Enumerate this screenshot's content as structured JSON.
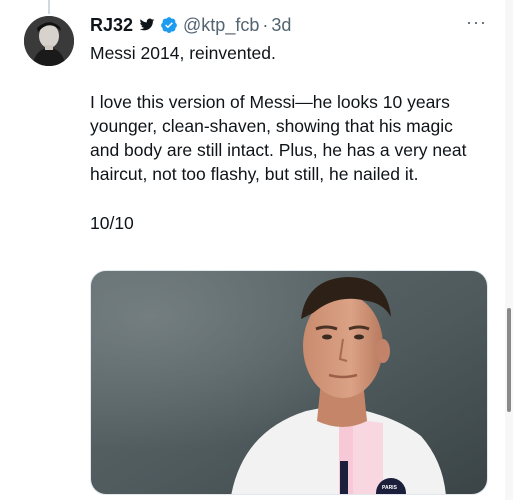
{
  "tweet": {
    "display_name": "RJ32",
    "handle": "@ktp_fcb",
    "separator": "·",
    "time": "3d",
    "line1": "Messi 2014, reinvented.",
    "body": "I love this version of Messi—he looks 10 years younger, clean-shaven, showing that his magic and body are still intact. Plus, he has a very neat haircut, not too flashy, but still, he nailed it.",
    "rating": "10/10",
    "more_label": "···"
  },
  "photo": {
    "jersey_crest_text": "PARIS"
  },
  "colors": {
    "text": "#0f1419",
    "secondary": "#536471",
    "verified": "#1d9bf0",
    "thread_line": "#cfd9de"
  },
  "icons": [
    "bird-icon",
    "verified-icon",
    "more-icon"
  ]
}
